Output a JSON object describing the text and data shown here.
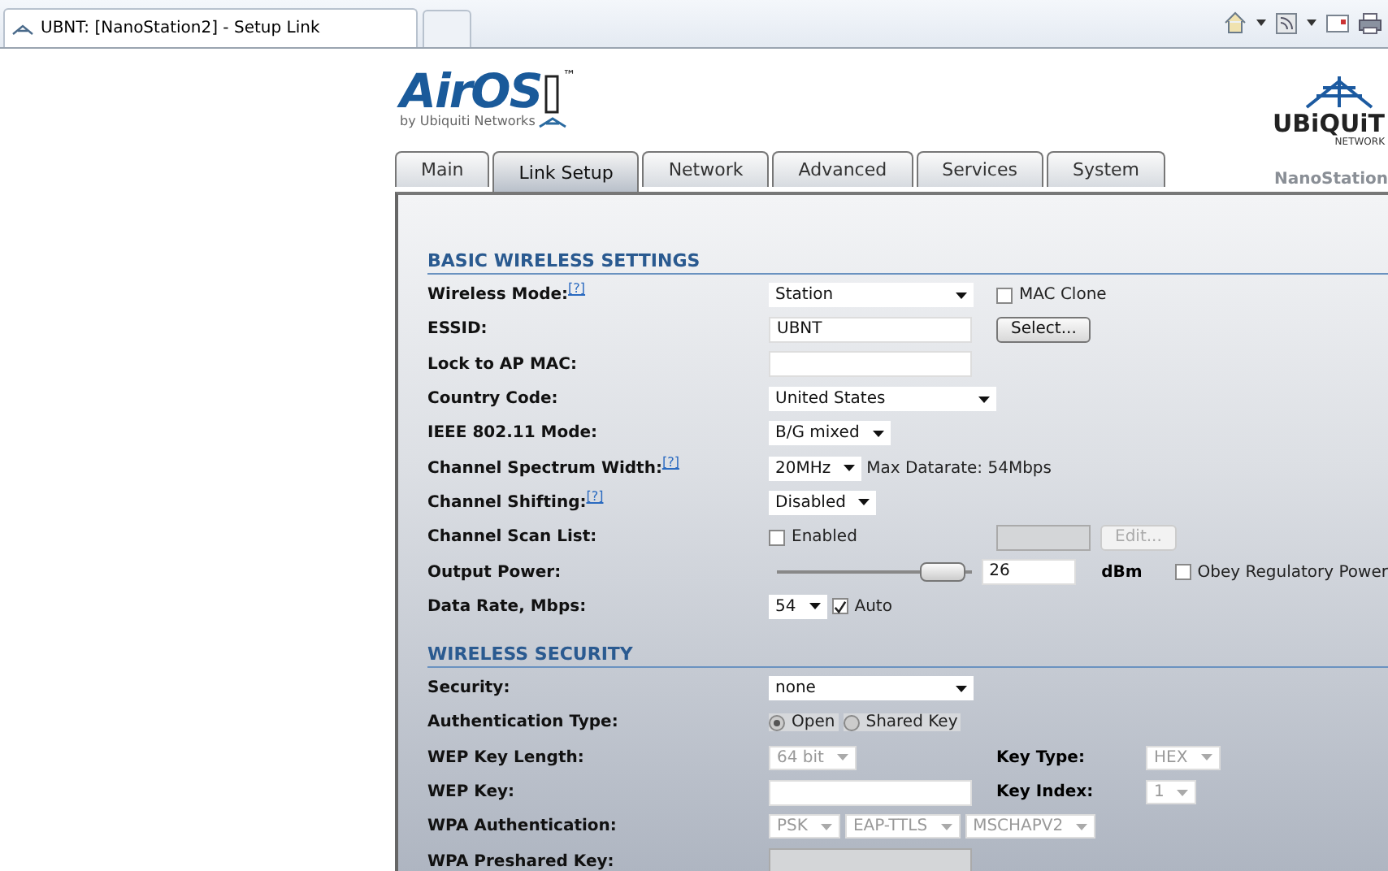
{
  "browser": {
    "tab_title": "UBNT: [NanoStation2] - Setup Link"
  },
  "logo": {
    "name": "AirOS",
    "trademark": "™",
    "byline": "by Ubiquiti Networks"
  },
  "brand": {
    "name": "UBiQUiT",
    "sub": "NETWORK",
    "device": "NanoStation"
  },
  "tabs": [
    {
      "label": "Main",
      "selected": false
    },
    {
      "label": "Link Setup",
      "selected": true
    },
    {
      "label": "Network",
      "selected": false
    },
    {
      "label": "Advanced",
      "selected": false
    },
    {
      "label": "Services",
      "selected": false
    },
    {
      "label": "System",
      "selected": false
    }
  ],
  "sections": [
    {
      "title": "BASIC WIRELESS SETTINGS",
      "rows": [
        {
          "label": "Wireless Mode:",
          "help": "[?]",
          "controls": [
            {
              "kind": "select",
              "value": "Station",
              "disabled": false
            }
          ],
          "side": [
            {
              "kind": "checkbox",
              "label": "MAC Clone",
              "checked": false,
              "disabled": false
            }
          ]
        },
        {
          "label": "ESSID:",
          "controls": [
            {
              "kind": "text",
              "value": "UBNT",
              "disabled": false
            }
          ],
          "side": [
            {
              "kind": "button",
              "label": "Select...",
              "disabled": false
            }
          ]
        },
        {
          "label": "Lock to AP MAC:",
          "controls": [
            {
              "kind": "text",
              "disabled": false
            }
          ]
        },
        {
          "label": "Country Code:",
          "controls": [
            {
              "kind": "select",
              "value": "United States",
              "disabled": false
            }
          ]
        },
        {
          "label": "IEEE 802.11 Mode:",
          "controls": [
            {
              "kind": "select",
              "value": "B/G mixed",
              "disabled": false
            }
          ]
        },
        {
          "label": "Channel Spectrum Width:",
          "help": "[?]",
          "controls": [
            {
              "kind": "select",
              "value": "20MHz",
              "disabled": false
            },
            {
              "kind": "note",
              "text": "Max Datarate: 54Mbps"
            }
          ]
        },
        {
          "label": "Channel Shifting:",
          "help": "[?]",
          "controls": [
            {
              "kind": "select",
              "value": "Disabled",
              "disabled": false
            }
          ]
        },
        {
          "label": "Channel Scan List:",
          "controls": [
            {
              "kind": "checkbox",
              "label": "Enabled",
              "checked": false,
              "disabled": false
            }
          ],
          "side": [
            {
              "kind": "text",
              "disabled": true
            },
            {
              "kind": "button",
              "label": "Edit...",
              "disabled": true
            }
          ]
        },
        {
          "label": "Output Power:",
          "controls": [
            {
              "kind": "slider",
              "level": 0.95
            }
          ],
          "side": [
            {
              "kind": "text",
              "value": "26",
              "disabled": false
            },
            {
              "kind": "unit",
              "text": "dBm"
            },
            {
              "kind": "checkbox",
              "label": "Obey Regulatory Power",
              "checked": false,
              "disabled": false
            }
          ]
        },
        {
          "label": "Data Rate, Mbps:",
          "controls": [
            {
              "kind": "select",
              "value": "54",
              "disabled": false
            },
            {
              "kind": "checkbox",
              "label": "Auto",
              "checked": true,
              "disabled": false
            }
          ]
        }
      ]
    },
    {
      "title": "WIRELESS SECURITY",
      "rows": [
        {
          "label": "Security:",
          "controls": [
            {
              "kind": "select",
              "value": "none",
              "disabled": false
            }
          ]
        },
        {
          "label": "Authentication Type:",
          "controls": [
            {
              "kind": "radio",
              "label": "Open",
              "selected": true,
              "disabled": true
            },
            {
              "kind": "radio",
              "label": "Shared Key",
              "selected": false,
              "disabled": true
            }
          ]
        },
        {
          "label": "WEP Key Length:",
          "controls": [
            {
              "kind": "select",
              "value": "64 bit",
              "disabled": true
            }
          ],
          "side": [
            {
              "kind": "label",
              "text": "Key Type:"
            },
            {
              "kind": "select",
              "value": "HEX",
              "disabled": true
            }
          ]
        },
        {
          "label": "WEP Key:",
          "controls": [
            {
              "kind": "text",
              "disabled": false
            }
          ],
          "side": [
            {
              "kind": "label",
              "text": "Key Index:"
            },
            {
              "kind": "select",
              "value": "1",
              "disabled": true
            }
          ]
        },
        {
          "label": "WPA Authentication:",
          "controls": [
            {
              "kind": "select",
              "value": "PSK",
              "disabled": true
            },
            {
              "kind": "select",
              "value": "EAP-TTLS",
              "disabled": true
            },
            {
              "kind": "select",
              "value": "MSCHAPV2",
              "disabled": true
            }
          ]
        },
        {
          "label": "WPA Preshared Key:",
          "controls": [
            {
              "kind": "text",
              "disabled": true
            }
          ]
        }
      ]
    }
  ]
}
